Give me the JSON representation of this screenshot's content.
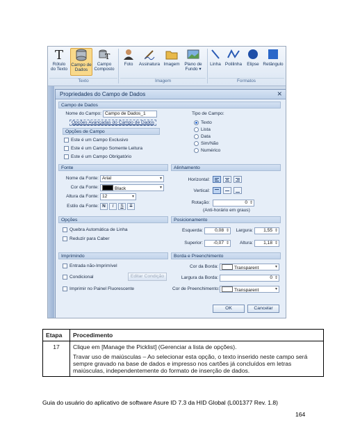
{
  "ribbon": {
    "buttons": [
      {
        "label": "Rótulo\ndo Texto",
        "icon": "text-t-icon"
      },
      {
        "label": "Campo de\nDados",
        "icon": "database-icon"
      },
      {
        "label": "Campo\nComposto",
        "icon": "composite-field-icon"
      },
      {
        "label": "Foto",
        "icon": "photo-person-icon"
      },
      {
        "label": "Assinatura",
        "icon": "signature-icon"
      },
      {
        "label": "Imagem",
        "icon": "folder-image-icon"
      },
      {
        "label": "Plano de\nFundo ▾",
        "icon": "background-icon"
      },
      {
        "label": "Linha",
        "icon": "line-icon"
      },
      {
        "label": "Polilinha",
        "icon": "polyline-icon"
      },
      {
        "label": "Elipse",
        "icon": "ellipse-icon"
      },
      {
        "label": "Retângulo",
        "icon": "rectangle-icon"
      }
    ],
    "groups": [
      "Texto",
      "Imagem",
      "Formatos"
    ]
  },
  "dialog": {
    "title": "Propriedades do Campo de Dados",
    "sections": {
      "campo_dados": "Campo de Dados",
      "opcoes_campo": "Opções de Campo",
      "fonte": "Fonte",
      "alinhamento": "Alinhamento",
      "opcoes": "Opções",
      "posicionamento": "Posicionamento",
      "imprimindo": "Imprimindo",
      "borda": "Borda e Preenchimento"
    },
    "field_name_label": "Nome do Campo:",
    "field_name_value": "Campo de Dados_1",
    "advanced_link": "Opções Avançadas do Campo de Dados",
    "field_type_label": "Tipo de Campo:",
    "field_types": [
      "Texto",
      "Lista",
      "Data",
      "Sim/Não",
      "Numérico"
    ],
    "field_options": [
      "Este é um Campo Exclusivo",
      "Este é um Campo Somente Leitura",
      "Este é um Campo Obrigatório"
    ],
    "font_name_label": "Nome da Fonte:",
    "font_name_value": "Arial",
    "font_color_label": "Cor da Fonte:",
    "font_color_value": "Black",
    "font_height_label": "Altura da Fonte:",
    "font_height_value": "12",
    "font_style_label": "Estilo da Fonte:",
    "font_styles": [
      "N",
      "I",
      "S",
      "T"
    ],
    "horizontal_label": "Horizontal:",
    "vertical_label": "Vertical:",
    "rotation_label": "Rotação:",
    "rotation_value": "0",
    "rotation_hint": "(Anti-horário em graus)",
    "options": [
      "Quebra Automática de Linha",
      "Reduzir para Caber"
    ],
    "left_label": "Esquerda:",
    "left_value": "0,08",
    "width_label": "Largura:",
    "width_value": "1,55",
    "top_label": "Superior:",
    "top_value": "-0,07",
    "height_label": "Altura:",
    "height_value": "1,18",
    "printing": [
      "Entrada não-Imprimível",
      "Condicional",
      "Imprimir no Painel Fluorescente"
    ],
    "edit_condition": "Editar Condição",
    "border_color_label": "Cor da Borda:",
    "border_color_value": "Transparent",
    "border_width_label": "Largura da Borda:",
    "border_width_value": "0",
    "fill_color_label": "Cor de Preenchimento:",
    "fill_color_value": "Transparent",
    "ok": "OK",
    "cancel": "Cancelar"
  },
  "table": {
    "headers": [
      "Etapa",
      "Procedimento"
    ],
    "step": "17",
    "line1": "Clique em [Manage the Picklist] (Gerenciar a lista de opções).",
    "line2": "Travar uso de maiúsculas – Ao selecionar esta opção, o texto inserido neste campo será sempre gravado na base de dados e impresso nos cartões já concluídos em letras maiúsculas, independentemente do formato de inserção de dados."
  },
  "footer": {
    "caption": "Guia do usuário do aplicativo de software Asure ID 7.3 da HID Global (L001377 Rev. 1.8)",
    "page": "164"
  }
}
